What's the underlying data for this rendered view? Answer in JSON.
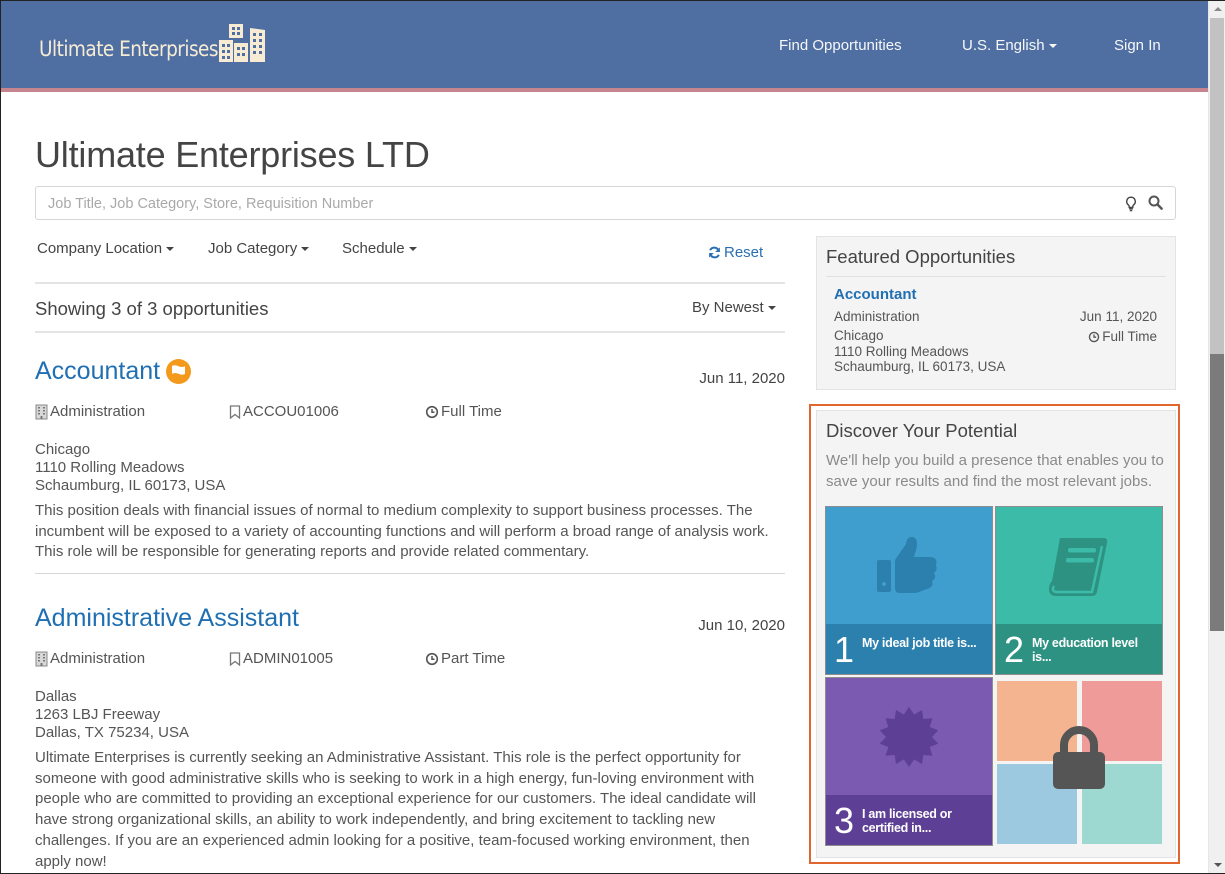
{
  "header": {
    "brand": "Ultimate Enterprises",
    "brand_color": "#f7ecd3",
    "bar_color": "#4f6fa3",
    "nav": {
      "find": "Find Opportunities",
      "language": "U.S. English",
      "sign_in": "Sign In"
    }
  },
  "page": {
    "title": "Ultimate Enterprises LTD",
    "search_placeholder": "Job Title, Job Category, Store, Requisition Number",
    "search_value": ""
  },
  "filters": {
    "items": [
      "Company Location",
      "Job Category",
      "Schedule"
    ],
    "reset": "Reset"
  },
  "results": {
    "count_text": "Showing 3 of 3 opportunities",
    "sort": "By Newest"
  },
  "jobs": [
    {
      "title": "Accountant",
      "featured_flag": true,
      "date": "Jun 11, 2020",
      "category": "Administration",
      "requisition": "ACCOU01006",
      "schedule": "Full Time",
      "address": [
        "Chicago",
        "1110 Rolling Meadows",
        "Schaumburg, IL 60173, USA"
      ],
      "description": "This position deals with financial issues of normal to medium complexity to support business processes. The incumbent will be exposed to a variety of accounting functions and will perform a broad range of analysis work. This role will be responsible for generating reports and provide related commentary."
    },
    {
      "title": "Administrative Assistant",
      "featured_flag": false,
      "date": "Jun 10, 2020",
      "category": "Administration",
      "requisition": "ADMIN01005",
      "schedule": "Part Time",
      "address": [
        "Dallas",
        "1263 LBJ Freeway",
        "Dallas, TX 75234, USA"
      ],
      "description": "Ultimate Enterprises is currently seeking an Administrative Assistant. This role is the perfect opportunity for someone with good administrative skills who is seeking to work in a high energy, fun-loving environment with people who are committed to providing an exceptional experience for our customers. The ideal candidate will have strong organizational skills, an ability to work independently, and bring excitement to tackling new challenges. If you are an experienced admin looking for a positive, team-focused working environment, then apply now!"
    }
  ],
  "featured": {
    "heading": "Featured Opportunities",
    "title": "Accountant",
    "category": "Administration",
    "date": "Jun 11, 2020",
    "schedule": "Full Time",
    "address": [
      "Chicago",
      "1110 Rolling Meadows",
      "Schaumburg, IL 60173, USA"
    ]
  },
  "discover": {
    "heading": "Discover Your Potential",
    "text": "We'll help you build a presence that enables you to save your results and find the most relevant jobs.",
    "tiles": [
      {
        "num": "1",
        "label": "My ideal job title is...",
        "icon": "thumbs-up-icon",
        "color": "#409ecf"
      },
      {
        "num": "2",
        "label": "My education level is...",
        "icon": "book-icon",
        "color": "#3dbba9"
      },
      {
        "num": "3",
        "label": "I am licensed or certified in...",
        "icon": "badge-icon",
        "color": "#7a5bb1"
      }
    ],
    "locked_icon": "lock-icon",
    "highlight_color": "#e0652e"
  }
}
